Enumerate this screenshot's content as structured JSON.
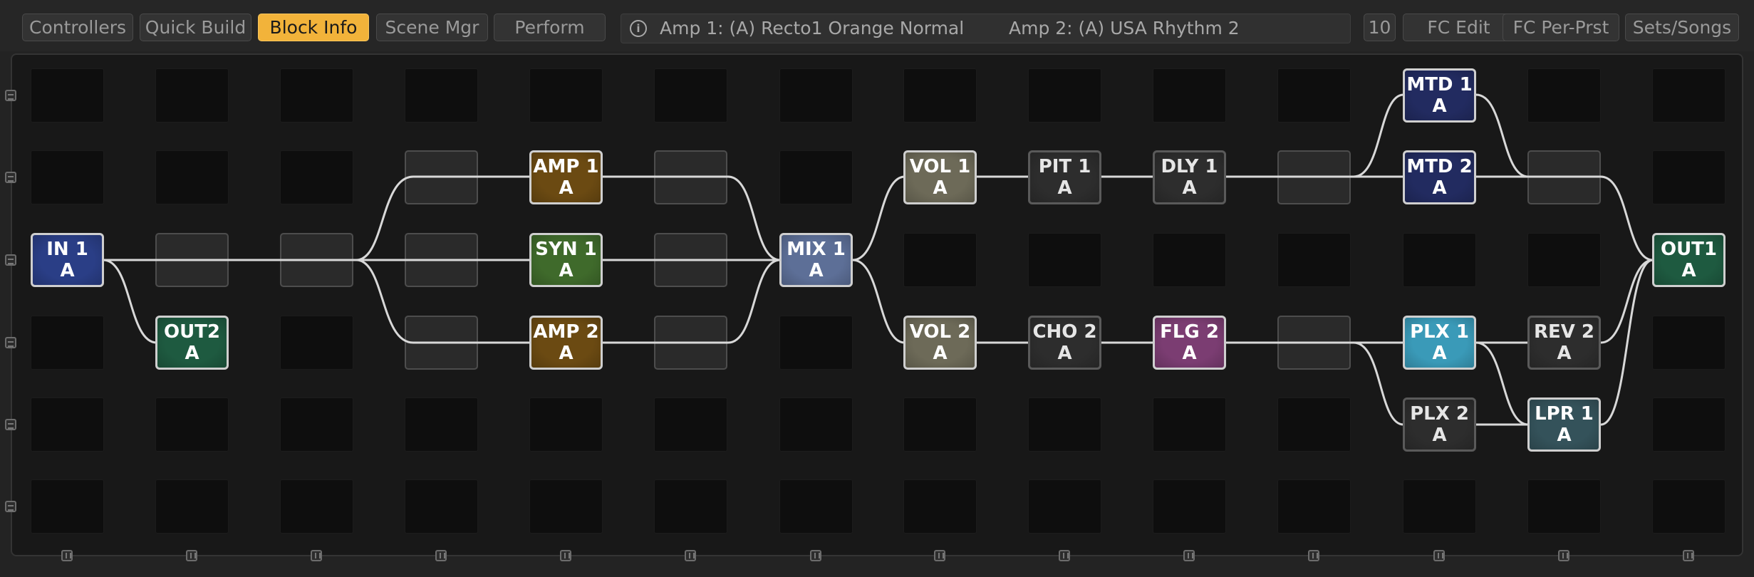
{
  "tabs": {
    "controllers": "Controllers",
    "quick_build": "Quick Build",
    "block_info": "Block Info",
    "scene_mgr": "Scene Mgr",
    "perform": "Perform"
  },
  "info": {
    "icon": "info-icon",
    "icon_glyph": "i",
    "amp1": "Amp 1: (A) Recto1 Orange Normal",
    "amp2": "Amp 2: (A) USA Rhythm 2"
  },
  "right_buttons": {
    "number": "10",
    "fc_edit": "FC Edit",
    "fc_per_prst": "FC Per-Prst",
    "sets_songs": "Sets/Songs"
  },
  "blocks": {
    "in1": {
      "name": "IN 1",
      "channel": "A",
      "color": "#2a3e86"
    },
    "out2": {
      "name": "OUT2",
      "channel": "A",
      "color": "#1e5a40"
    },
    "amp1": {
      "name": "AMP 1",
      "channel": "A",
      "color": "#6b4a12"
    },
    "syn1": {
      "name": "SYN 1",
      "channel": "A",
      "color": "#3f6a2b"
    },
    "amp2": {
      "name": "AMP 2",
      "channel": "A",
      "color": "#6b4a12"
    },
    "mix1": {
      "name": "MIX 1",
      "channel": "A",
      "color": "#5d6f97"
    },
    "vol1": {
      "name": "VOL 1",
      "channel": "A",
      "color": "#6d6a58"
    },
    "vol2": {
      "name": "VOL 2",
      "channel": "A",
      "color": "#6d6a58"
    },
    "pit1": {
      "name": "PIT 1",
      "channel": "A",
      "color": "#2d2d2d"
    },
    "cho2": {
      "name": "CHO 2",
      "channel": "A",
      "color": "#2d2d2d"
    },
    "dly1": {
      "name": "DLY 1",
      "channel": "A",
      "color": "#2d2d2d"
    },
    "flg2": {
      "name": "FLG 2",
      "channel": "A",
      "color": "#7b3d72"
    },
    "mtd1": {
      "name": "MTD 1",
      "channel": "A",
      "color": "#222b60"
    },
    "mtd2": {
      "name": "MTD 2",
      "channel": "A",
      "color": "#222b60"
    },
    "plx1": {
      "name": "PLX 1",
      "channel": "A",
      "color": "#3a9ab8"
    },
    "plx2": {
      "name": "PLX 2",
      "channel": "A",
      "color": "#2d2d2d"
    },
    "rev2": {
      "name": "REV 2",
      "channel": "A",
      "color": "#2d2d2d"
    },
    "lpr1": {
      "name": "LPR 1",
      "channel": "A",
      "color": "#34525a"
    },
    "out1": {
      "name": "OUT1",
      "channel": "A",
      "color": "#1e5a40"
    }
  },
  "colors": {
    "accent": "#f2b33a",
    "cable": "#d8d8d8"
  }
}
